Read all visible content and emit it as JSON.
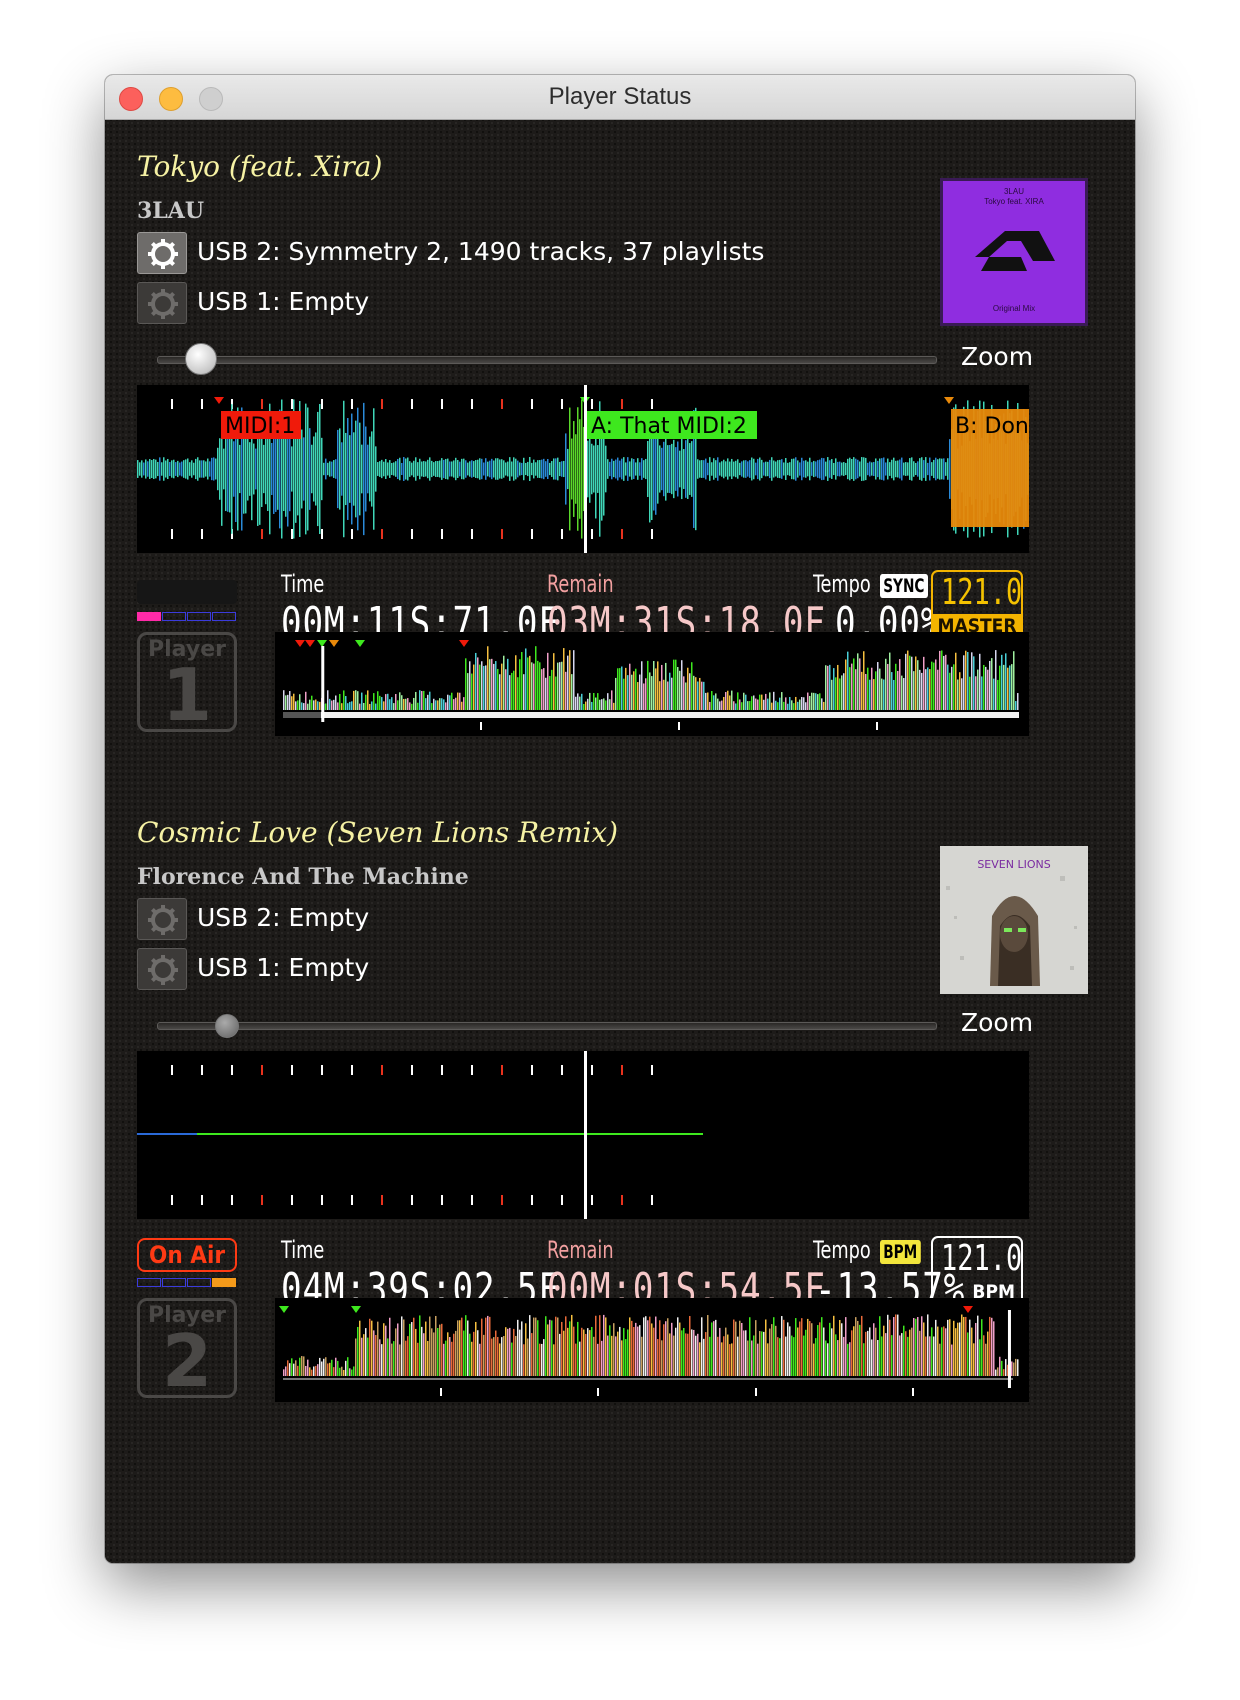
{
  "window": {
    "title": "Player Status"
  },
  "players": [
    {
      "title": "Tokyo (feat. Xira)",
      "artist": "3LAU",
      "usb2": "USB 2: Symmetry 2, 1490 tracks, 37 playlists",
      "usb1": "USB 1: Empty",
      "zoom_label": "Zoom",
      "zoom_level": 0.06,
      "cues": [
        "MIDI:1",
        "A: That MIDI:2",
        "B: Don"
      ],
      "labels": {
        "time": "Time",
        "remain": "Remain",
        "tempo": "Tempo"
      },
      "time": "00M:11S:71.0F",
      "remain": "03M:31S:18.0F",
      "tempo": "0.00%",
      "tempo_badge": "SYNC",
      "bpm": "121.0",
      "bpm_label": "MASTER",
      "on_air": "",
      "player_word": "Player",
      "player_number": "1",
      "art": {
        "line1": "3LAU",
        "line2": "Tokyo feat. XIRA",
        "line3": "Original Mix"
      },
      "position_fraction": 0.052,
      "accent_colors": {
        "sync": "#ffffff",
        "bpm_box": "#f4b400"
      }
    },
    {
      "title": "Cosmic Love (Seven Lions Remix)",
      "artist": "Florence And The Machine",
      "usb2": "USB 2: Empty",
      "usb1": "USB 1: Empty",
      "zoom_label": "Zoom",
      "zoom_level": 0.1,
      "cues": [],
      "labels": {
        "time": "Time",
        "remain": "Remain",
        "tempo": "Tempo"
      },
      "time": "04M:39S:02.5F",
      "remain": "00M:01S:54.5F",
      "tempo": "-13.57%",
      "tempo_badge": "BPM",
      "bpm": "121.0",
      "bpm_label": "BPM",
      "on_air": "On Air",
      "player_word": "Player",
      "player_number": "2",
      "art": {
        "line1": "SEVEN LIONS"
      },
      "position_fraction": 0.985,
      "accent_colors": {
        "on_air": "#ff3a14",
        "bpm_badge": "#f3e63c"
      }
    }
  ]
}
